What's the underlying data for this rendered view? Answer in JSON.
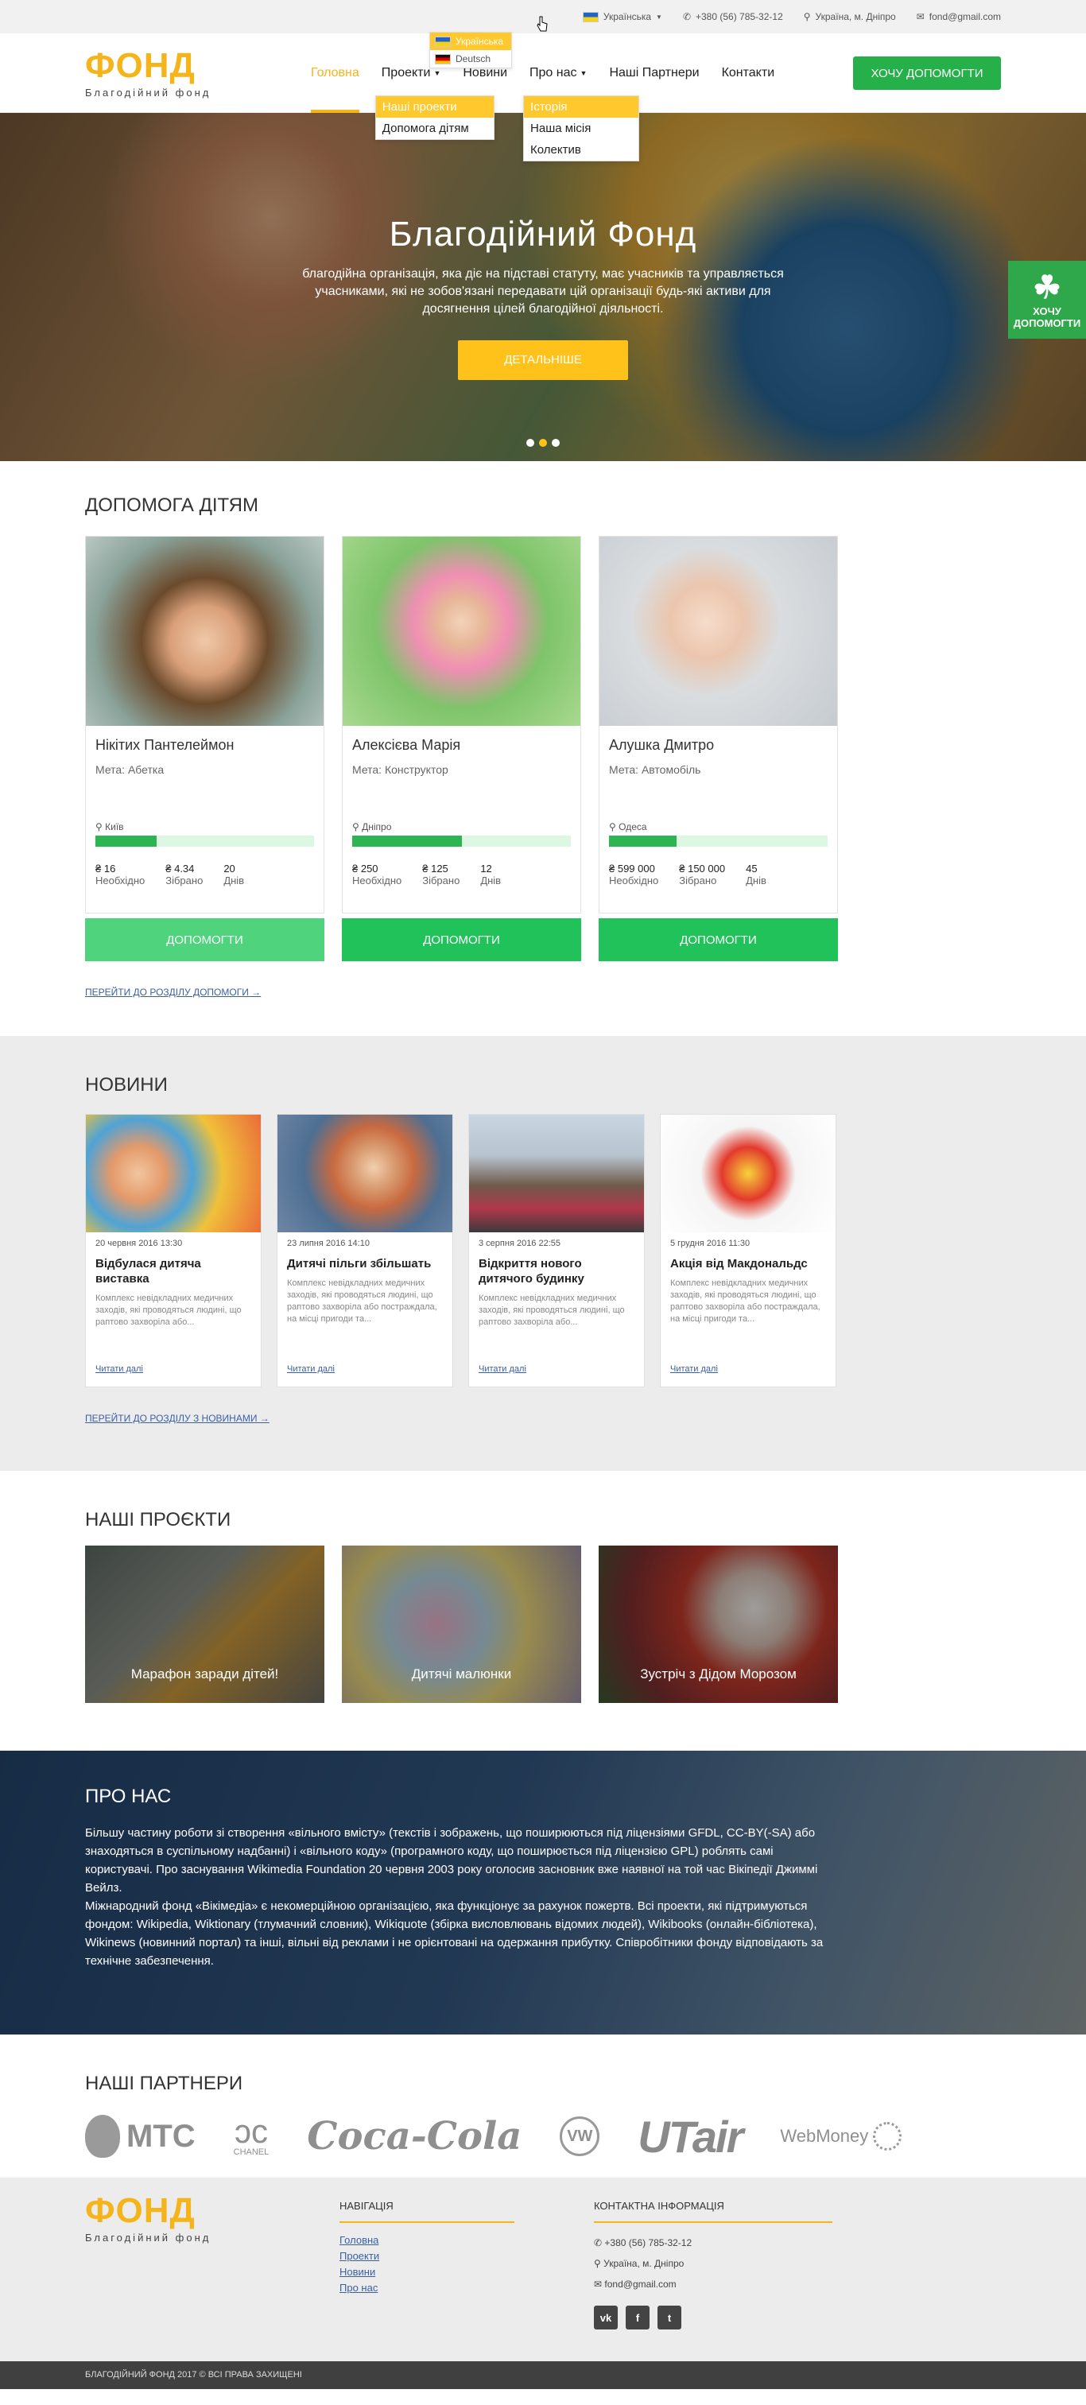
{
  "topbar": {
    "language": "Українська",
    "phone": "+380 (56) 785-32-12",
    "location": "Україна, м. Дніпро",
    "email": "fond@gmail.com",
    "lang_options": [
      "Українська",
      "Deutsch"
    ]
  },
  "header": {
    "logo_title": "ФОНД",
    "logo_subtitle": "Благодійний фонд",
    "nav": [
      "Головна",
      "Проекти",
      "Новини",
      "Про нас",
      "Наші Партнери",
      "Контакти"
    ],
    "projects_menu": [
      "Наші проекти",
      "Допомога дітям"
    ],
    "about_menu": [
      "Історія",
      "Наша місія",
      "Колектив"
    ],
    "cta": "ХОЧУ ДОПОМОГТИ"
  },
  "hero": {
    "title": "Благодійний Фонд",
    "text": "благодійна організація, яка діє на підставі статуту, має учасників та управляється учасниками, які не зобов'язані передавати цій організації будь-які активи для досягнення цілей благодійної діяльності.",
    "button": "ДЕТАЛЬНІШЕ",
    "side_button": "ХОЧУ ДОПОМОГТИ"
  },
  "kids": {
    "title": "ДОПОМОГА ДІТЯМ",
    "items": [
      {
        "name": "Нікітих Пантелеймон",
        "goal": "Мета: Абетка",
        "city": "Київ",
        "need": "₴ 16",
        "raised": "₴ 4.34",
        "days": "20",
        "progress": 0.28
      },
      {
        "name": "Алексієва Марія",
        "goal": "Мета: Конструктор",
        "city": "Дніпро",
        "need": "₴ 250",
        "raised": "₴ 125",
        "days": "12",
        "progress": 0.5
      },
      {
        "name": "Алушка Дмитро",
        "goal": "Мета: Автомобіль",
        "city": "Одеса",
        "need": "₴ 599 000",
        "raised": "₴ 150 000",
        "days": "45",
        "progress": 0.31
      }
    ],
    "need_label": "Необхідно",
    "raised_label": "Зібрано",
    "days_label": "Днів",
    "button": "ДОПОМОГТИ",
    "more": "ПЕРЕЙТИ ДО РОЗДІЛУ ДОПОМОГИ →"
  },
  "news": {
    "title": "НОВИНИ",
    "items": [
      {
        "date": "20 червня 2016 13:30",
        "title": "Відбулася дитяча виставка",
        "text": "Комплекс невідкладних медичних заходів, які проводяться людині, що раптово захворіла або..."
      },
      {
        "date": "23 липня 2016 14:10",
        "title": "Дитячі пільги збільшать",
        "text": "Комплекс невідкладних медичних заходів, які проводяться людині, що раптово захворіла або постраждала, на місці пригоди та..."
      },
      {
        "date": "3 серпня 2016 22:55",
        "title": "Відкриття нового дитячого будинку",
        "text": "Комплекс невідкладних медичних заходів, які проводяться людині, що раптово захворіла або..."
      },
      {
        "date": "5 грудня 2016 11:30",
        "title": "Акція від Макдональдс",
        "text": "Комплекс невідкладних медичних заходів, які проводяться людині, що раптово захворіла або постраждала, на місці пригоди та..."
      }
    ],
    "read_more": "Читати далі",
    "more": "ПЕРЕЙТИ ДО РОЗДІЛУ З НОВИНАМИ →"
  },
  "projects": {
    "title": "НАШІ ПРОЄКТИ",
    "items": [
      "Марафон заради дітей!",
      "Дитячі малюнки",
      "Зустріч з Дідом Морозом"
    ]
  },
  "about": {
    "title": "ПРО НАС",
    "p1": "Більшу частину роботи зі створення «вільного вмісту» (текстів і зображень, що поширюються під ліцензіями GFDL, CC-BY(-SA) або знаходяться в суспільному надбанні) і «вільного коду» (програмного коду, що поширюється під ліцензією GPL) роблять самі користувачі. Про заснування Wikimedia Foundation 20 червня 2003 року оголосив засновник вже наявної на той час Вікіпедії Джиммі Вейлз.",
    "p2": "Міжнародний фонд «Вікімедіа» є некомерційною організацією, яка функціонує за рахунок пожертв. Всі проекти, які підтримуються фондом: Wikipedia, Wiktionary (тлумачний словник), Wikiquote (збірка висловлювань відомих людей), Wikibooks (онлайн-бібліотека), Wikinews (новинний портал) та інші, вільні від реклами і не орієнтовані на одержання прибутку. Співробітники фонду відповідають за технічне забезпечення."
  },
  "partners": {
    "title": "НАШІ ПАРТНЕРИ",
    "logos": [
      "МТС",
      "CHANEL",
      "Coca-Cola",
      "VW",
      "UTair",
      "WebMoney"
    ]
  },
  "footer": {
    "nav_title": "НАВІГАЦІЯ",
    "nav": [
      "Головна",
      "Проекти",
      "Новини",
      "Про нас"
    ],
    "contact_title": "КОНТАКТНА ІНФОРМАЦІЯ",
    "phone": "+380 (56) 785-32-12",
    "location": "Україна, м. Дніпро",
    "email": "fond@gmail.com",
    "social": [
      "vk",
      "f",
      "t"
    ],
    "copyright": "БЛАГОДІЙНИЙ ФОНД 2017 © ВСІ ПРАВА ЗАХИЩЕНІ"
  }
}
